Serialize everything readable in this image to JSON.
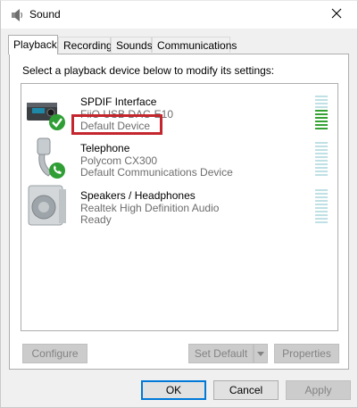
{
  "window": {
    "title": "Sound"
  },
  "tabs": [
    {
      "label": "Playback"
    },
    {
      "label": "Recording"
    },
    {
      "label": "Sounds"
    },
    {
      "label": "Communications"
    }
  ],
  "instruction": "Select a playback device below to modify its settings:",
  "devices": [
    {
      "name": "SPDIF Interface",
      "line2": "FiiO USB DAC-E10",
      "line3": "Default Device",
      "level": 0.58
    },
    {
      "name": "Telephone",
      "line2": "Polycom CX300",
      "line3": "Default Communications Device",
      "level": 0
    },
    {
      "name": "Speakers / Headphones",
      "line2": "Realtek High Definition Audio",
      "line3": "Ready",
      "level": 0
    }
  ],
  "buttons": {
    "configure": "Configure",
    "set_default": "Set Default",
    "properties": "Properties",
    "ok": "OK",
    "cancel": "Cancel",
    "apply": "Apply"
  },
  "colors": {
    "highlight": "#c4262e",
    "meter_on": "#34a334",
    "meter_off": "#bfe0e4",
    "accent": "#0078d7"
  },
  "icons": {
    "title": "speaker-icon",
    "close": "close-icon",
    "dropdown": "chevron-down-icon"
  }
}
